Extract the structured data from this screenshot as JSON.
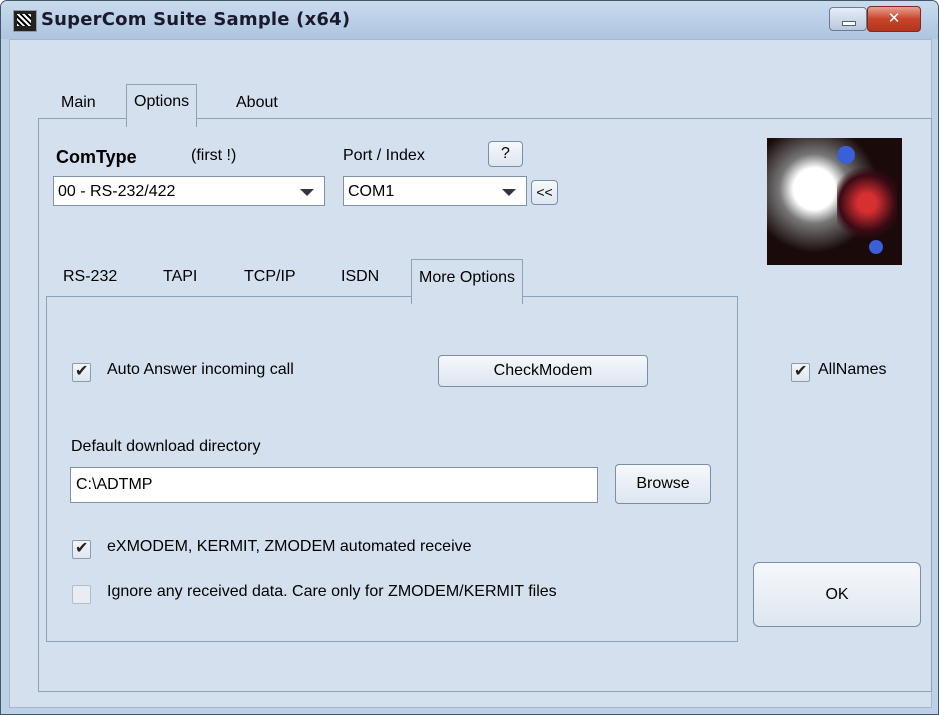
{
  "window": {
    "title": "SuperCom Suite Sample  (x64)",
    "close_glyph": "✕"
  },
  "main_tabs": [
    {
      "label": "Main"
    },
    {
      "label": "Options"
    },
    {
      "label": "About"
    }
  ],
  "comtype": {
    "label": "ComType",
    "hint": "(first !)",
    "value": "00 - RS-232/422"
  },
  "port": {
    "label": "Port / Index",
    "help_label": "?",
    "value": "COM1",
    "nav_label": "<<"
  },
  "sub_tabs": [
    {
      "label": "RS-232"
    },
    {
      "label": "TAPI"
    },
    {
      "label": "TCP/IP"
    },
    {
      "label": "ISDN"
    },
    {
      "label": "More Options"
    }
  ],
  "more_options": {
    "auto_answer": {
      "label": "Auto Answer incoming call",
      "checked": true
    },
    "check_modem_label": "CheckModem",
    "download_dir_label": "Default download directory",
    "download_dir_value": "C:\\ADTMP",
    "browse_label": "Browse",
    "auto_receive": {
      "label": "eXMODEM, KERMIT, ZMODEM automated receive",
      "checked": true
    },
    "ignore_data": {
      "label": "Ignore any received data. Care only for ZMODEM/KERMIT files",
      "checked": false
    }
  },
  "allnames": {
    "label": "AllNames",
    "checked": true
  },
  "ok_label": "OK",
  "check_glyph": "✔"
}
